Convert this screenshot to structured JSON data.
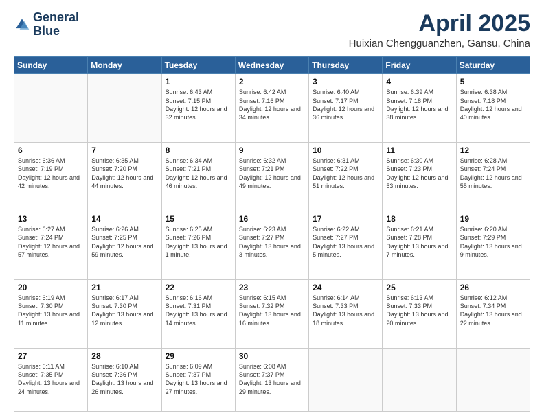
{
  "header": {
    "logo_line1": "General",
    "logo_line2": "Blue",
    "month": "April 2025",
    "location": "Huixian Chengguanzhen, Gansu, China"
  },
  "days_of_week": [
    "Sunday",
    "Monday",
    "Tuesday",
    "Wednesday",
    "Thursday",
    "Friday",
    "Saturday"
  ],
  "weeks": [
    [
      {
        "day": "",
        "sunrise": "",
        "sunset": "",
        "daylight": ""
      },
      {
        "day": "",
        "sunrise": "",
        "sunset": "",
        "daylight": ""
      },
      {
        "day": "1",
        "sunrise": "Sunrise: 6:43 AM",
        "sunset": "Sunset: 7:15 PM",
        "daylight": "Daylight: 12 hours and 32 minutes."
      },
      {
        "day": "2",
        "sunrise": "Sunrise: 6:42 AM",
        "sunset": "Sunset: 7:16 PM",
        "daylight": "Daylight: 12 hours and 34 minutes."
      },
      {
        "day": "3",
        "sunrise": "Sunrise: 6:40 AM",
        "sunset": "Sunset: 7:17 PM",
        "daylight": "Daylight: 12 hours and 36 minutes."
      },
      {
        "day": "4",
        "sunrise": "Sunrise: 6:39 AM",
        "sunset": "Sunset: 7:18 PM",
        "daylight": "Daylight: 12 hours and 38 minutes."
      },
      {
        "day": "5",
        "sunrise": "Sunrise: 6:38 AM",
        "sunset": "Sunset: 7:18 PM",
        "daylight": "Daylight: 12 hours and 40 minutes."
      }
    ],
    [
      {
        "day": "6",
        "sunrise": "Sunrise: 6:36 AM",
        "sunset": "Sunset: 7:19 PM",
        "daylight": "Daylight: 12 hours and 42 minutes."
      },
      {
        "day": "7",
        "sunrise": "Sunrise: 6:35 AM",
        "sunset": "Sunset: 7:20 PM",
        "daylight": "Daylight: 12 hours and 44 minutes."
      },
      {
        "day": "8",
        "sunrise": "Sunrise: 6:34 AM",
        "sunset": "Sunset: 7:21 PM",
        "daylight": "Daylight: 12 hours and 46 minutes."
      },
      {
        "day": "9",
        "sunrise": "Sunrise: 6:32 AM",
        "sunset": "Sunset: 7:21 PM",
        "daylight": "Daylight: 12 hours and 49 minutes."
      },
      {
        "day": "10",
        "sunrise": "Sunrise: 6:31 AM",
        "sunset": "Sunset: 7:22 PM",
        "daylight": "Daylight: 12 hours and 51 minutes."
      },
      {
        "day": "11",
        "sunrise": "Sunrise: 6:30 AM",
        "sunset": "Sunset: 7:23 PM",
        "daylight": "Daylight: 12 hours and 53 minutes."
      },
      {
        "day": "12",
        "sunrise": "Sunrise: 6:28 AM",
        "sunset": "Sunset: 7:24 PM",
        "daylight": "Daylight: 12 hours and 55 minutes."
      }
    ],
    [
      {
        "day": "13",
        "sunrise": "Sunrise: 6:27 AM",
        "sunset": "Sunset: 7:24 PM",
        "daylight": "Daylight: 12 hours and 57 minutes."
      },
      {
        "day": "14",
        "sunrise": "Sunrise: 6:26 AM",
        "sunset": "Sunset: 7:25 PM",
        "daylight": "Daylight: 12 hours and 59 minutes."
      },
      {
        "day": "15",
        "sunrise": "Sunrise: 6:25 AM",
        "sunset": "Sunset: 7:26 PM",
        "daylight": "Daylight: 13 hours and 1 minute."
      },
      {
        "day": "16",
        "sunrise": "Sunrise: 6:23 AM",
        "sunset": "Sunset: 7:27 PM",
        "daylight": "Daylight: 13 hours and 3 minutes."
      },
      {
        "day": "17",
        "sunrise": "Sunrise: 6:22 AM",
        "sunset": "Sunset: 7:27 PM",
        "daylight": "Daylight: 13 hours and 5 minutes."
      },
      {
        "day": "18",
        "sunrise": "Sunrise: 6:21 AM",
        "sunset": "Sunset: 7:28 PM",
        "daylight": "Daylight: 13 hours and 7 minutes."
      },
      {
        "day": "19",
        "sunrise": "Sunrise: 6:20 AM",
        "sunset": "Sunset: 7:29 PM",
        "daylight": "Daylight: 13 hours and 9 minutes."
      }
    ],
    [
      {
        "day": "20",
        "sunrise": "Sunrise: 6:19 AM",
        "sunset": "Sunset: 7:30 PM",
        "daylight": "Daylight: 13 hours and 11 minutes."
      },
      {
        "day": "21",
        "sunrise": "Sunrise: 6:17 AM",
        "sunset": "Sunset: 7:30 PM",
        "daylight": "Daylight: 13 hours and 12 minutes."
      },
      {
        "day": "22",
        "sunrise": "Sunrise: 6:16 AM",
        "sunset": "Sunset: 7:31 PM",
        "daylight": "Daylight: 13 hours and 14 minutes."
      },
      {
        "day": "23",
        "sunrise": "Sunrise: 6:15 AM",
        "sunset": "Sunset: 7:32 PM",
        "daylight": "Daylight: 13 hours and 16 minutes."
      },
      {
        "day": "24",
        "sunrise": "Sunrise: 6:14 AM",
        "sunset": "Sunset: 7:33 PM",
        "daylight": "Daylight: 13 hours and 18 minutes."
      },
      {
        "day": "25",
        "sunrise": "Sunrise: 6:13 AM",
        "sunset": "Sunset: 7:33 PM",
        "daylight": "Daylight: 13 hours and 20 minutes."
      },
      {
        "day": "26",
        "sunrise": "Sunrise: 6:12 AM",
        "sunset": "Sunset: 7:34 PM",
        "daylight": "Daylight: 13 hours and 22 minutes."
      }
    ],
    [
      {
        "day": "27",
        "sunrise": "Sunrise: 6:11 AM",
        "sunset": "Sunset: 7:35 PM",
        "daylight": "Daylight: 13 hours and 24 minutes."
      },
      {
        "day": "28",
        "sunrise": "Sunrise: 6:10 AM",
        "sunset": "Sunset: 7:36 PM",
        "daylight": "Daylight: 13 hours and 26 minutes."
      },
      {
        "day": "29",
        "sunrise": "Sunrise: 6:09 AM",
        "sunset": "Sunset: 7:37 PM",
        "daylight": "Daylight: 13 hours and 27 minutes."
      },
      {
        "day": "30",
        "sunrise": "Sunrise: 6:08 AM",
        "sunset": "Sunset: 7:37 PM",
        "daylight": "Daylight: 13 hours and 29 minutes."
      },
      {
        "day": "",
        "sunrise": "",
        "sunset": "",
        "daylight": ""
      },
      {
        "day": "",
        "sunrise": "",
        "sunset": "",
        "daylight": ""
      },
      {
        "day": "",
        "sunrise": "",
        "sunset": "",
        "daylight": ""
      }
    ]
  ]
}
